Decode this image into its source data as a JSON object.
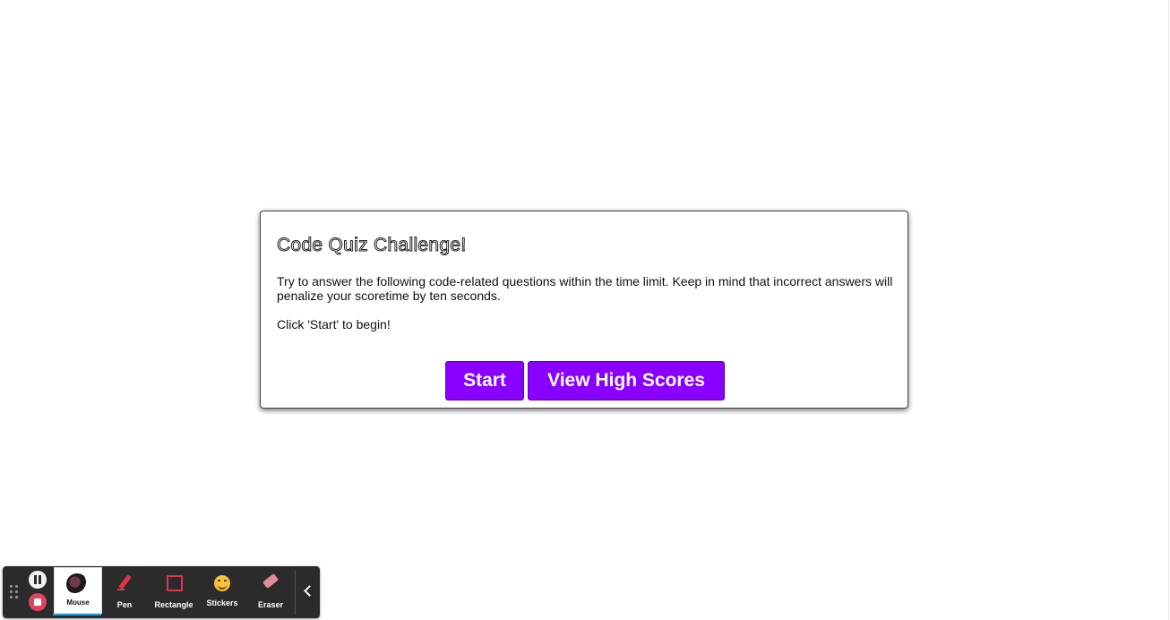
{
  "quiz": {
    "title": "Code Quiz Challenge!",
    "description": "Try to answer the following code-related questions within the time limit. Keep in mind that incorrect answers will penalize your scoretime by ten seconds.",
    "instruction": "Click 'Start' to begin!",
    "start_label": "Start",
    "high_scores_label": "View High Scores"
  },
  "toolbar": {
    "camera_label": "Mouse",
    "tools": [
      {
        "label": "Pen",
        "icon": "pen-icon"
      },
      {
        "label": "Rectangle",
        "icon": "rectangle-icon"
      },
      {
        "label": "Stickers",
        "icon": "sticker-icon"
      },
      {
        "label": "Eraser",
        "icon": "eraser-icon"
      }
    ]
  },
  "colors": {
    "button_primary": "#8a00ff",
    "toolbar_bg": "#2b2b2b",
    "stop_red": "#e0435f",
    "tool_red": "#e3324b"
  }
}
